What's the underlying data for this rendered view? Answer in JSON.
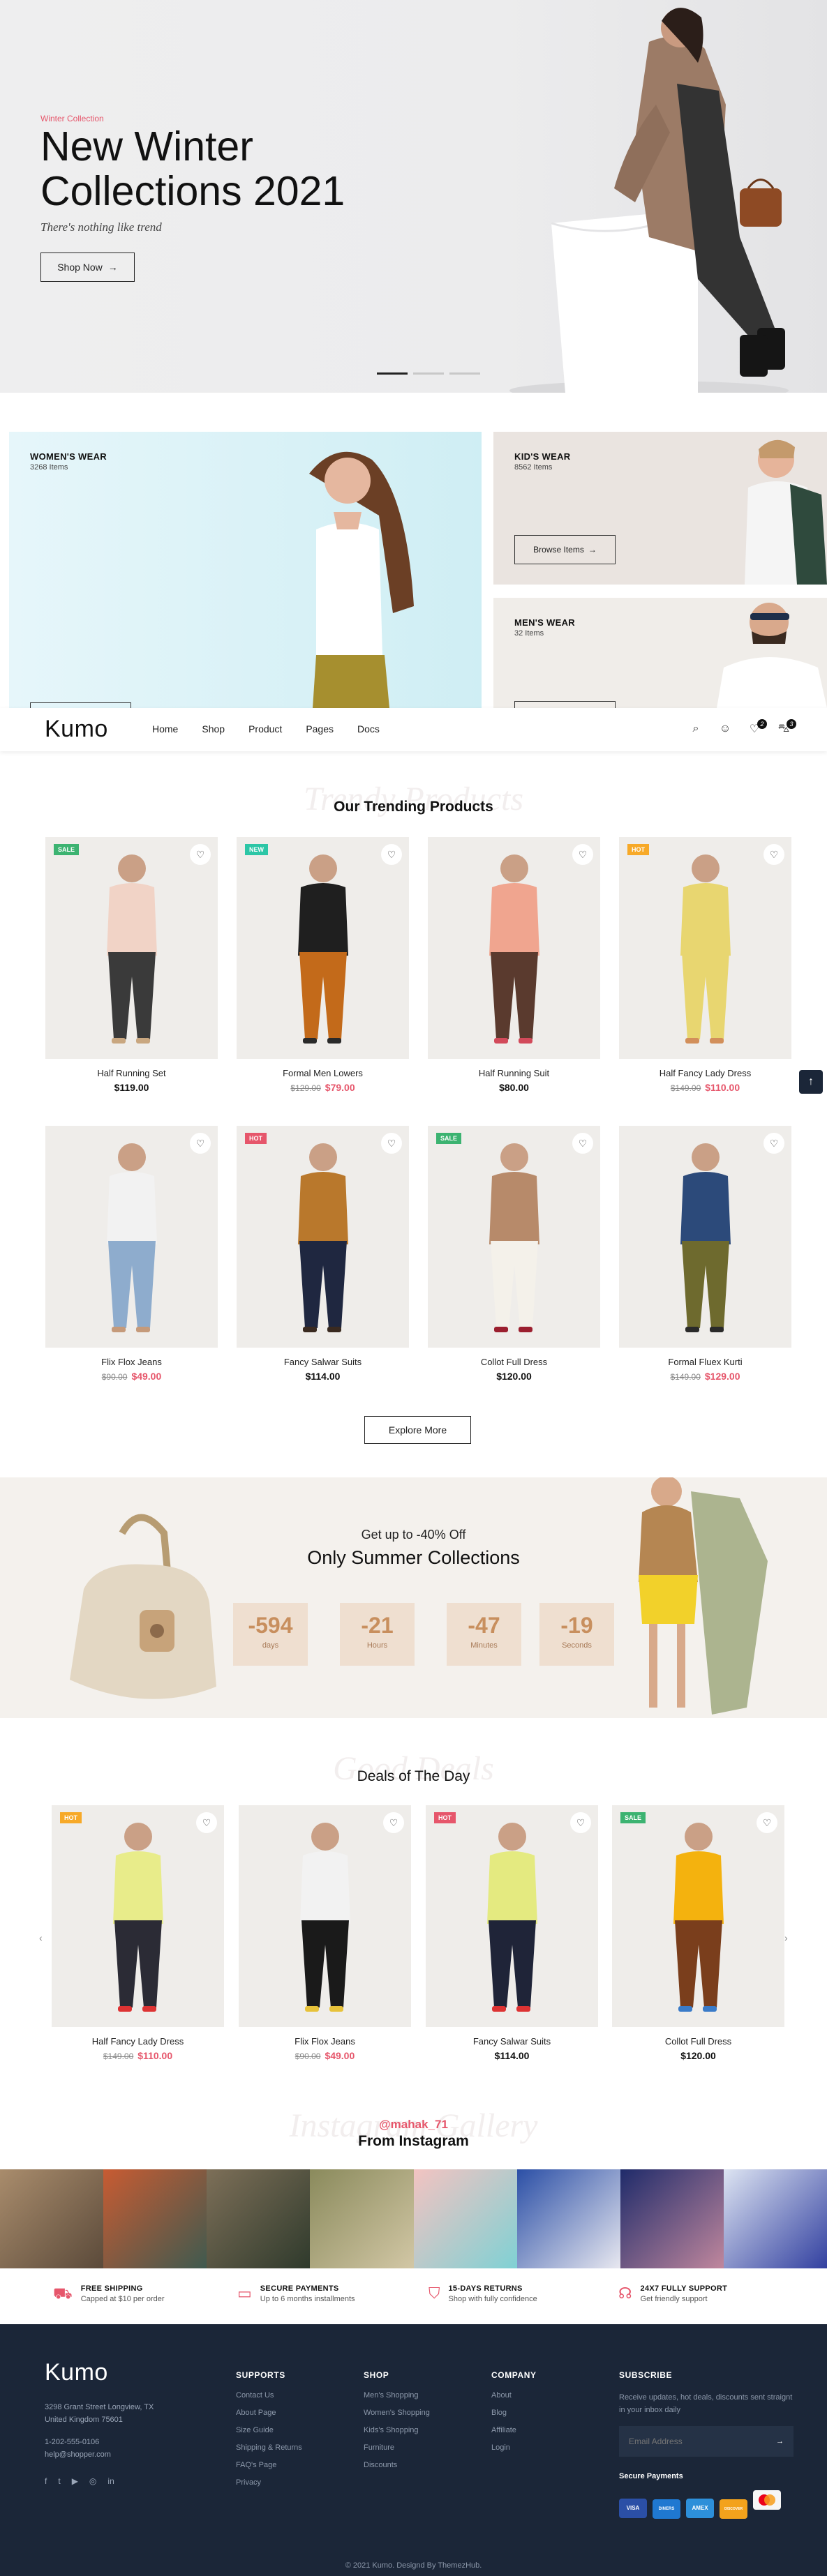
{
  "hero": {
    "kicker": "Winter Collection",
    "title": "New Winter Collections 2021",
    "subtitle": "There's nothing like trend",
    "button": "Shop Now",
    "dots": 3
  },
  "categories": [
    {
      "title": "WOMEN'S WEAR",
      "count": "3268 Items"
    },
    {
      "title": "KID'S WEAR",
      "count": "8562 Items",
      "button": "Browse Items"
    },
    {
      "title": "MEN'S WEAR",
      "count": "32 Items"
    }
  ],
  "nav": {
    "logo": "Kumo",
    "links": [
      "Home",
      "Shop",
      "Product",
      "Pages",
      "Docs"
    ],
    "wishlist_count": "2",
    "cart_count": "3"
  },
  "trending": {
    "ghost": "Trendy Products",
    "title": "Our Trending Products",
    "explore": "Explore More",
    "products": [
      {
        "name": "Half Running Set",
        "price": "$119.00",
        "old": "",
        "tag": "SALE",
        "tag_color": "#3cb371"
      },
      {
        "name": "Formal Men Lowers",
        "price": "$79.00",
        "old": "$129.00",
        "tag": "NEW",
        "tag_color": "#2cc6a6"
      },
      {
        "name": "Half Running Suit",
        "price": "$80.00",
        "old": "",
        "tag": "",
        "tag_color": ""
      },
      {
        "name": "Half Fancy Lady Dress",
        "price": "$110.00",
        "old": "$149.00",
        "tag": "HOT",
        "tag_color": "#f7a928"
      },
      {
        "name": "Flix Flox Jeans",
        "price": "$49.00",
        "old": "$90.00",
        "tag": "",
        "tag_color": ""
      },
      {
        "name": "Fancy Salwar Suits",
        "price": "$114.00",
        "old": "",
        "tag": "HOT",
        "tag_color": "#e6566b"
      },
      {
        "name": "Collot Full Dress",
        "price": "$120.00",
        "old": "",
        "tag": "SALE",
        "tag_color": "#3cb371"
      },
      {
        "name": "Formal Fluex Kurti",
        "price": "$129.00",
        "old": "$149.00",
        "tag": "",
        "tag_color": ""
      }
    ]
  },
  "countdown": {
    "kicker": "Get up to -40% Off",
    "title": "Only Summer Collections",
    "items": [
      {
        "value": "-594",
        "label": "days"
      },
      {
        "value": "-21",
        "label": "Hours"
      },
      {
        "value": "-47",
        "label": "Minutes"
      },
      {
        "value": "-19",
        "label": "Seconds"
      }
    ]
  },
  "deals": {
    "ghost": "Good Deals",
    "title": "Deals of The Day",
    "products": [
      {
        "name": "Half Fancy Lady Dress",
        "price": "$110.00",
        "old": "$149.00",
        "tag": "HOT",
        "tag_color": "#f7a928"
      },
      {
        "name": "Flix Flox Jeans",
        "price": "$49.00",
        "old": "$90.00",
        "tag": "",
        "tag_color": ""
      },
      {
        "name": "Fancy Salwar Suits",
        "price": "$114.00",
        "old": "",
        "tag": "HOT",
        "tag_color": "#e6566b"
      },
      {
        "name": "Collot Full Dress",
        "price": "$120.00",
        "old": "",
        "tag": "SALE",
        "tag_color": "#3cb371"
      }
    ]
  },
  "instagram": {
    "ghost": "Instagram Gallery",
    "handle": "@mahak_71",
    "title": "From Instagram"
  },
  "features": [
    {
      "title": "FREE SHIPPING",
      "desc": "Capped at $10 per order",
      "icon": "truck-icon"
    },
    {
      "title": "SECURE PAYMENTS",
      "desc": "Up to 6 months installments",
      "icon": "credit-card-icon"
    },
    {
      "title": "15-DAYS RETURNS",
      "desc": "Shop with fully confidence",
      "icon": "shield-icon"
    },
    {
      "title": "24X7 FULLY SUPPORT",
      "desc": "Get friendly support",
      "icon": "headset-icon"
    }
  ],
  "footer": {
    "logo": "Kumo",
    "address1": "3298 Grant Street Longview, TX",
    "address2": "United Kingdom 75601",
    "phone": "1-202-555-0106",
    "email": "help@shopper.com",
    "columns": [
      {
        "heading": "SUPPORTS",
        "items": [
          "Contact Us",
          "About Page",
          "Size Guide",
          "Shipping & Returns",
          "FAQ's Page",
          "Privacy"
        ]
      },
      {
        "heading": "SHOP",
        "items": [
          "Men's Shopping",
          "Women's Shopping",
          "Kids's Shopping",
          "Furniture",
          "Discounts"
        ]
      },
      {
        "heading": "COMPANY",
        "items": [
          "About",
          "Blog",
          "Affiliate",
          "Login"
        ]
      }
    ],
    "subscribe": {
      "heading": "SUBSCRIBE",
      "text": "Receive updates, hot deals, discounts sent straignt in your inbox daily",
      "placeholder": "Email Address",
      "payments_label": "Secure Payments"
    },
    "payments": [
      "VISA",
      "DINERS",
      "AMEX",
      "DISCOVER",
      "MASTERCARD"
    ],
    "copyright": "© 2021 Kumo. Designd By ThemezHub."
  }
}
